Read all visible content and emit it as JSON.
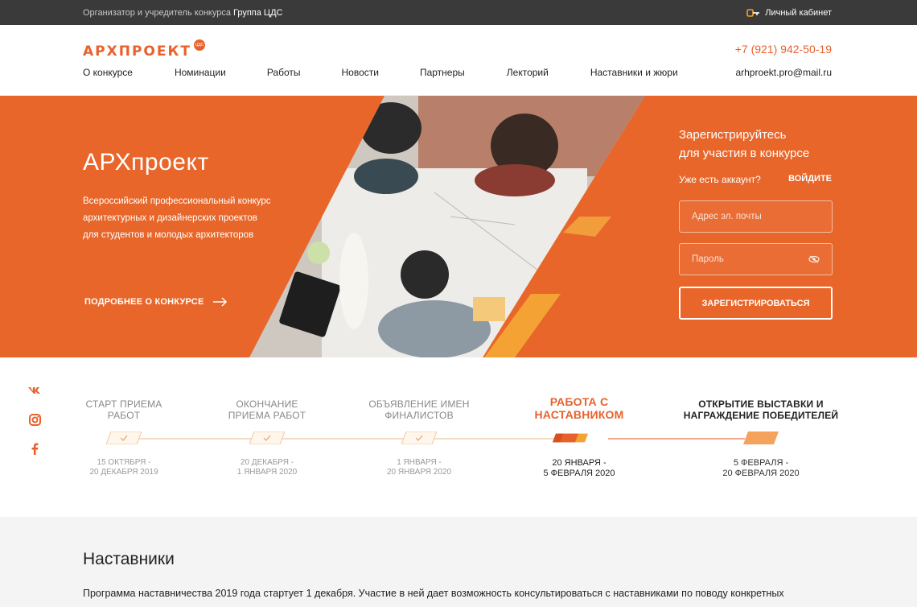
{
  "topbar": {
    "org_prefix": "Организатор и учредитель конкурса",
    "org_name": "Группа ЦДС",
    "cabinet_label": "Личный кабинет"
  },
  "header": {
    "logo_text": "АРХПРОЕКТ",
    "logo_badge": "ЦДС",
    "phone": "+7 (921) 942-50-19",
    "email": "arhproekt.pro@mail.ru",
    "nav": [
      "О конкурсе",
      "Номинации",
      "Работы",
      "Новости",
      "Партнеры",
      "Лекторий",
      "Наставники и жюри"
    ]
  },
  "hero": {
    "title": "АРХпроект",
    "desc": [
      "Всероссийский профессиональный конкурс",
      "архитектурных и дизайнерских проектов",
      "для студентов и молодых архитекторов"
    ],
    "more_label": "ПОДРОБНЕЕ О КОНКУРСЕ"
  },
  "register": {
    "title_line1": "Зарегистрируйтесь",
    "title_line2": "для участия в конкурсе",
    "account_q": "Уже есть аккаунт?",
    "login_label": "ВОЙДИТЕ",
    "email_placeholder": "Адрес эл. почты",
    "password_placeholder": "Пароль",
    "submit_label": "ЗАРЕГИСТРИРОВАТЬСЯ"
  },
  "social": [
    "vk",
    "instagram",
    "facebook"
  ],
  "timeline": [
    {
      "title1": "СТАРТ ПРИЕМА",
      "title2": "РАБОТ",
      "date1": "15 ОКТЯБРЯ -",
      "date2": "20 ДЕКАБРЯ 2019",
      "state": "done"
    },
    {
      "title1": "ОКОНЧАНИЕ",
      "title2": "ПРИЕМА РАБОТ",
      "date1": "20 ДЕКАБРЯ -",
      "date2": "1 ЯНВАРЯ 2020",
      "state": "done"
    },
    {
      "title1": "ОБЪЯВЛЕНИЕ ИМЕН",
      "title2": "ФИНАЛИСТОВ",
      "date1": "1 ЯНВАРЯ -",
      "date2": "20 ЯНВАРЯ 2020",
      "state": "done"
    },
    {
      "title1": "РАБОТА С",
      "title2": "НАСТАВНИКОМ",
      "date1": "20 ЯНВАРЯ -",
      "date2": "5 ФЕВРАЛЯ 2020",
      "state": "current"
    },
    {
      "title1": "ОТКРЫТИЕ ВЫСТАВКИ И",
      "title2": "НАГРАЖДЕНИЕ ПОБЕДИТЕЛЕЙ",
      "date1": "5 ФЕВРАЛЯ -",
      "date2": "20 ФЕВРАЛЯ 2020",
      "state": "next"
    }
  ],
  "mentors": {
    "title": "Наставники",
    "text": "Программа наставничества  2019 года стартует 1 декабря. Участие в ней дает возможность консультироваться с наставниками по поводу конкретных"
  },
  "colors": {
    "accent": "#e8612c",
    "hero_bg": "#e8662a",
    "topbar_bg": "#3a3a3a"
  }
}
